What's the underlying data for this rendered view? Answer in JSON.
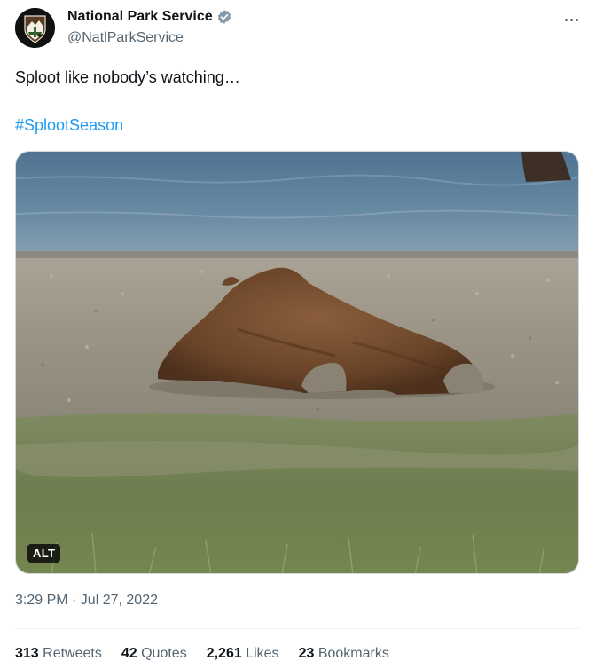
{
  "account": {
    "display_name": "National Park Service",
    "handle": "@NatlParkService",
    "verified": true
  },
  "tweet": {
    "text": "Sploot like nobody’s watching…",
    "hashtag": "#SplootSeason",
    "media_alt_badge": "ALT",
    "timestamp": "3:29 PM · Jul 27, 2022"
  },
  "stats": [
    {
      "count": "313",
      "label": "Retweets"
    },
    {
      "count": "42",
      "label": "Quotes"
    },
    {
      "count": "2,261",
      "label": "Likes"
    },
    {
      "count": "23",
      "label": "Bookmarks"
    }
  ],
  "icons": {
    "verified": "verified-badge-icon",
    "more": "more-horizontal-icon"
  },
  "colors": {
    "link": "#1d9bf0",
    "secondary_text": "#536471",
    "primary_text": "#0f1419",
    "verified": "#1d9bf0"
  }
}
